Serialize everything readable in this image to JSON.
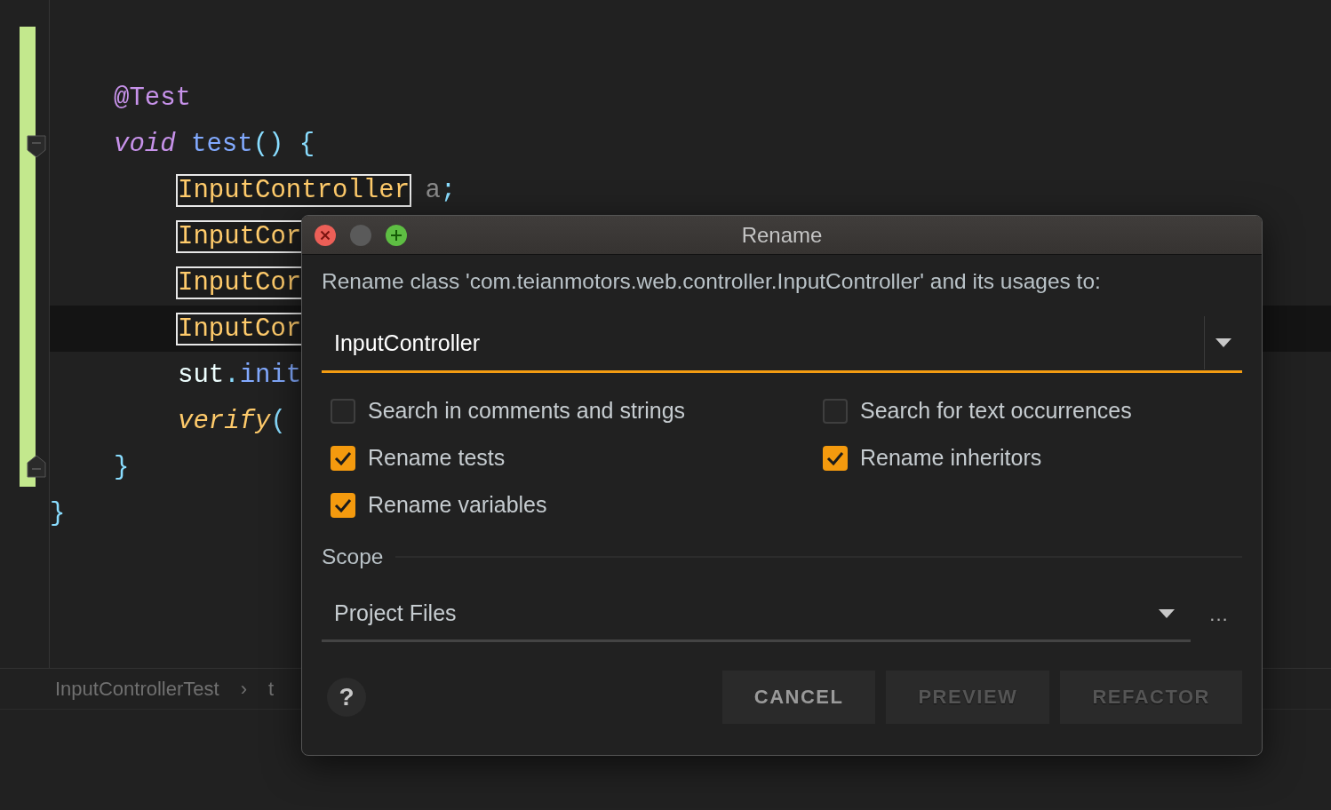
{
  "editor": {
    "lines": [
      {
        "children": [
          {
            "tokens": [
              {
                "text": "@Test",
                "kind": "annotation"
              }
            ]
          },
          {
            "tokens": [
              {
                "text": "void",
                "kind": "keyword"
              },
              {
                "text": "test",
                "kind": "method"
              },
              {
                "text": "() {",
                "kind": "punct"
              }
            ],
            "children": [
              {
                "current": false,
                "tokens": [
                  {
                    "text": "InputController",
                    "kind": "usage"
                  },
                  {
                    "text": " a",
                    "kind": "muted"
                  },
                  {
                    "text": ";",
                    "kind": "punct"
                  }
                ]
              },
              {
                "current": false,
                "tokens": [
                  {
                    "text": "InputCor",
                    "kind": "usage"
                  }
                ]
              },
              {
                "current": false,
                "tokens": [
                  {
                    "text": "InputCor",
                    "kind": "usage"
                  }
                ]
              },
              {
                "current": true,
                "tokens": [
                  {
                    "text": "InputCor",
                    "kind": "usage"
                  }
                ]
              },
              {
                "current": false,
                "tokens": [
                  {
                    "text": "sut",
                    "kind": "plain"
                  },
                  {
                    "text": ".",
                    "kind": "punct"
                  },
                  {
                    "text": "init",
                    "kind": "method"
                  }
                ]
              },
              {
                "current": false,
                "tokens": [
                  {
                    "text": "verify",
                    "kind": "call"
                  },
                  {
                    "text": "(",
                    "kind": "punct"
                  }
                ]
              }
            ]
          },
          {
            "tokens": [
              {
                "text": "}",
                "kind": "punct"
              }
            ]
          }
        ]
      },
      {
        "tokens": [
          {
            "text": "}",
            "kind": "punct"
          }
        ]
      }
    ]
  },
  "breadcrumbs": [
    "InputControllerTest",
    "›",
    "t"
  ],
  "dialog": {
    "title": "Rename",
    "window_buttons": [
      {
        "kind": "close",
        "disabled": false
      },
      {
        "kind": "minimize",
        "disabled": true
      },
      {
        "kind": "zoom",
        "disabled": false
      }
    ],
    "message": "Rename class 'com.teianmotors.web.controller.InputController' and its usages to:",
    "name_field": {
      "value": "InputController"
    },
    "options": [
      {
        "label": "Search in comments and strings",
        "checked": false
      },
      {
        "label": "Search for text occurrences",
        "checked": false
      },
      {
        "label": "Rename tests",
        "checked": true
      },
      {
        "label": "Rename inheritors",
        "checked": true
      },
      {
        "label": "Rename variables",
        "checked": true
      }
    ],
    "scope": {
      "label": "Scope",
      "value": "Project Files",
      "more": "..."
    },
    "help": "?",
    "buttons": [
      {
        "label": "CANCEL",
        "disabled": false
      },
      {
        "label": "PREVIEW",
        "disabled": true
      },
      {
        "label": "REFACTOR",
        "disabled": true
      }
    ]
  }
}
